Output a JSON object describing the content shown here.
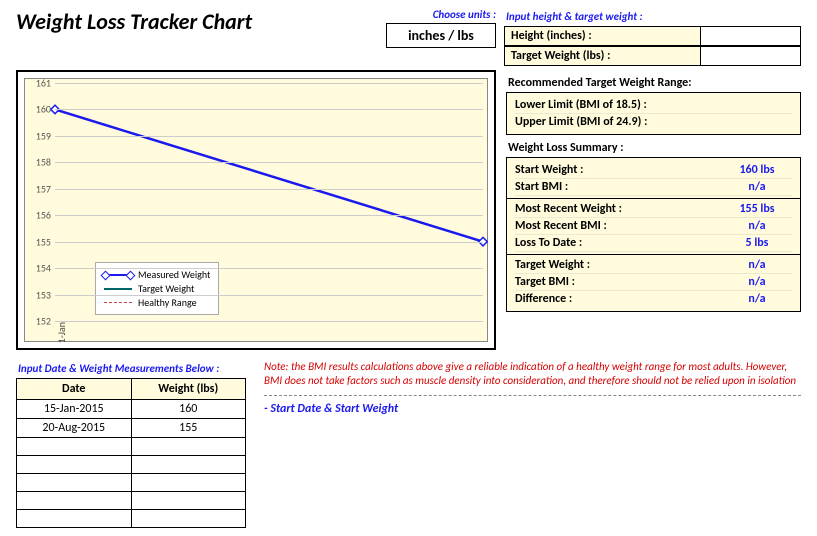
{
  "title": "Weight Loss Tracker Chart",
  "units": {
    "label": "Choose units :",
    "value": "inches / lbs"
  },
  "input_ht": {
    "label": "Input height & target weight :",
    "rows": [
      {
        "k": "Height (inches) :",
        "v": ""
      },
      {
        "k": "Target Weight (lbs) :",
        "v": ""
      }
    ]
  },
  "range": {
    "heading": "Recommended Target Weight Range:",
    "rows": [
      {
        "k": "Lower Limit (BMI of 18.5) :",
        "v": ""
      },
      {
        "k": "Upper Limit (BMI of 24.9) :",
        "v": ""
      }
    ]
  },
  "summary": {
    "heading": "Weight Loss Summary :",
    "groups": [
      [
        {
          "k": "Start Weight :",
          "v": "160 lbs"
        },
        {
          "k": "Start BMI :",
          "v": "n/a"
        }
      ],
      [
        {
          "k": "Most Recent Weight :",
          "v": "155 lbs"
        },
        {
          "k": "Most Recent BMI :",
          "v": "n/a"
        },
        {
          "k": "Loss To Date :",
          "v": "5 lbs"
        }
      ],
      [
        {
          "k": "Target Weight :",
          "v": "n/a"
        },
        {
          "k": "Target BMI :",
          "v": "n/a"
        },
        {
          "k": "Difference :",
          "v": "n/a"
        }
      ]
    ]
  },
  "input_table": {
    "label": "Input Date & Weight Measurements Below :",
    "headers": [
      "Date",
      "Weight (lbs)"
    ],
    "rows": [
      [
        "15-Jan-2015",
        "160"
      ],
      [
        "20-Aug-2015",
        "155"
      ],
      [
        "",
        ""
      ],
      [
        "",
        ""
      ],
      [
        "",
        ""
      ],
      [
        "",
        ""
      ],
      [
        "",
        ""
      ]
    ]
  },
  "note": "Note: the BMI results calculations above give a reliable indication of a healthy weight range for most adults. However, BMI does not take factors such as muscle density into consideration, and therefore should not be relied upon in isolation",
  "start_hint": "- Start Date & Start Weight",
  "legend": {
    "measured": "Measured Weight",
    "target": "Target Weight",
    "healthy": "Healthy Range"
  },
  "chart_data": {
    "type": "line",
    "title": "",
    "xlabel": "",
    "ylabel": "",
    "ylim": [
      152,
      161
    ],
    "yticks": [
      152,
      153,
      154,
      155,
      156,
      157,
      158,
      159,
      160,
      161
    ],
    "xticks": [
      "1-Jan"
    ],
    "series": [
      {
        "name": "Measured Weight",
        "x": [
          "15-Jan-2015",
          "20-Aug-2015"
        ],
        "values": [
          160,
          155
        ],
        "color": "#1a1aef"
      },
      {
        "name": "Target Weight",
        "x": [],
        "values": [],
        "color": "#006666"
      },
      {
        "name": "Healthy Range",
        "x": [],
        "values": [],
        "color": "#cc4444"
      }
    ]
  }
}
